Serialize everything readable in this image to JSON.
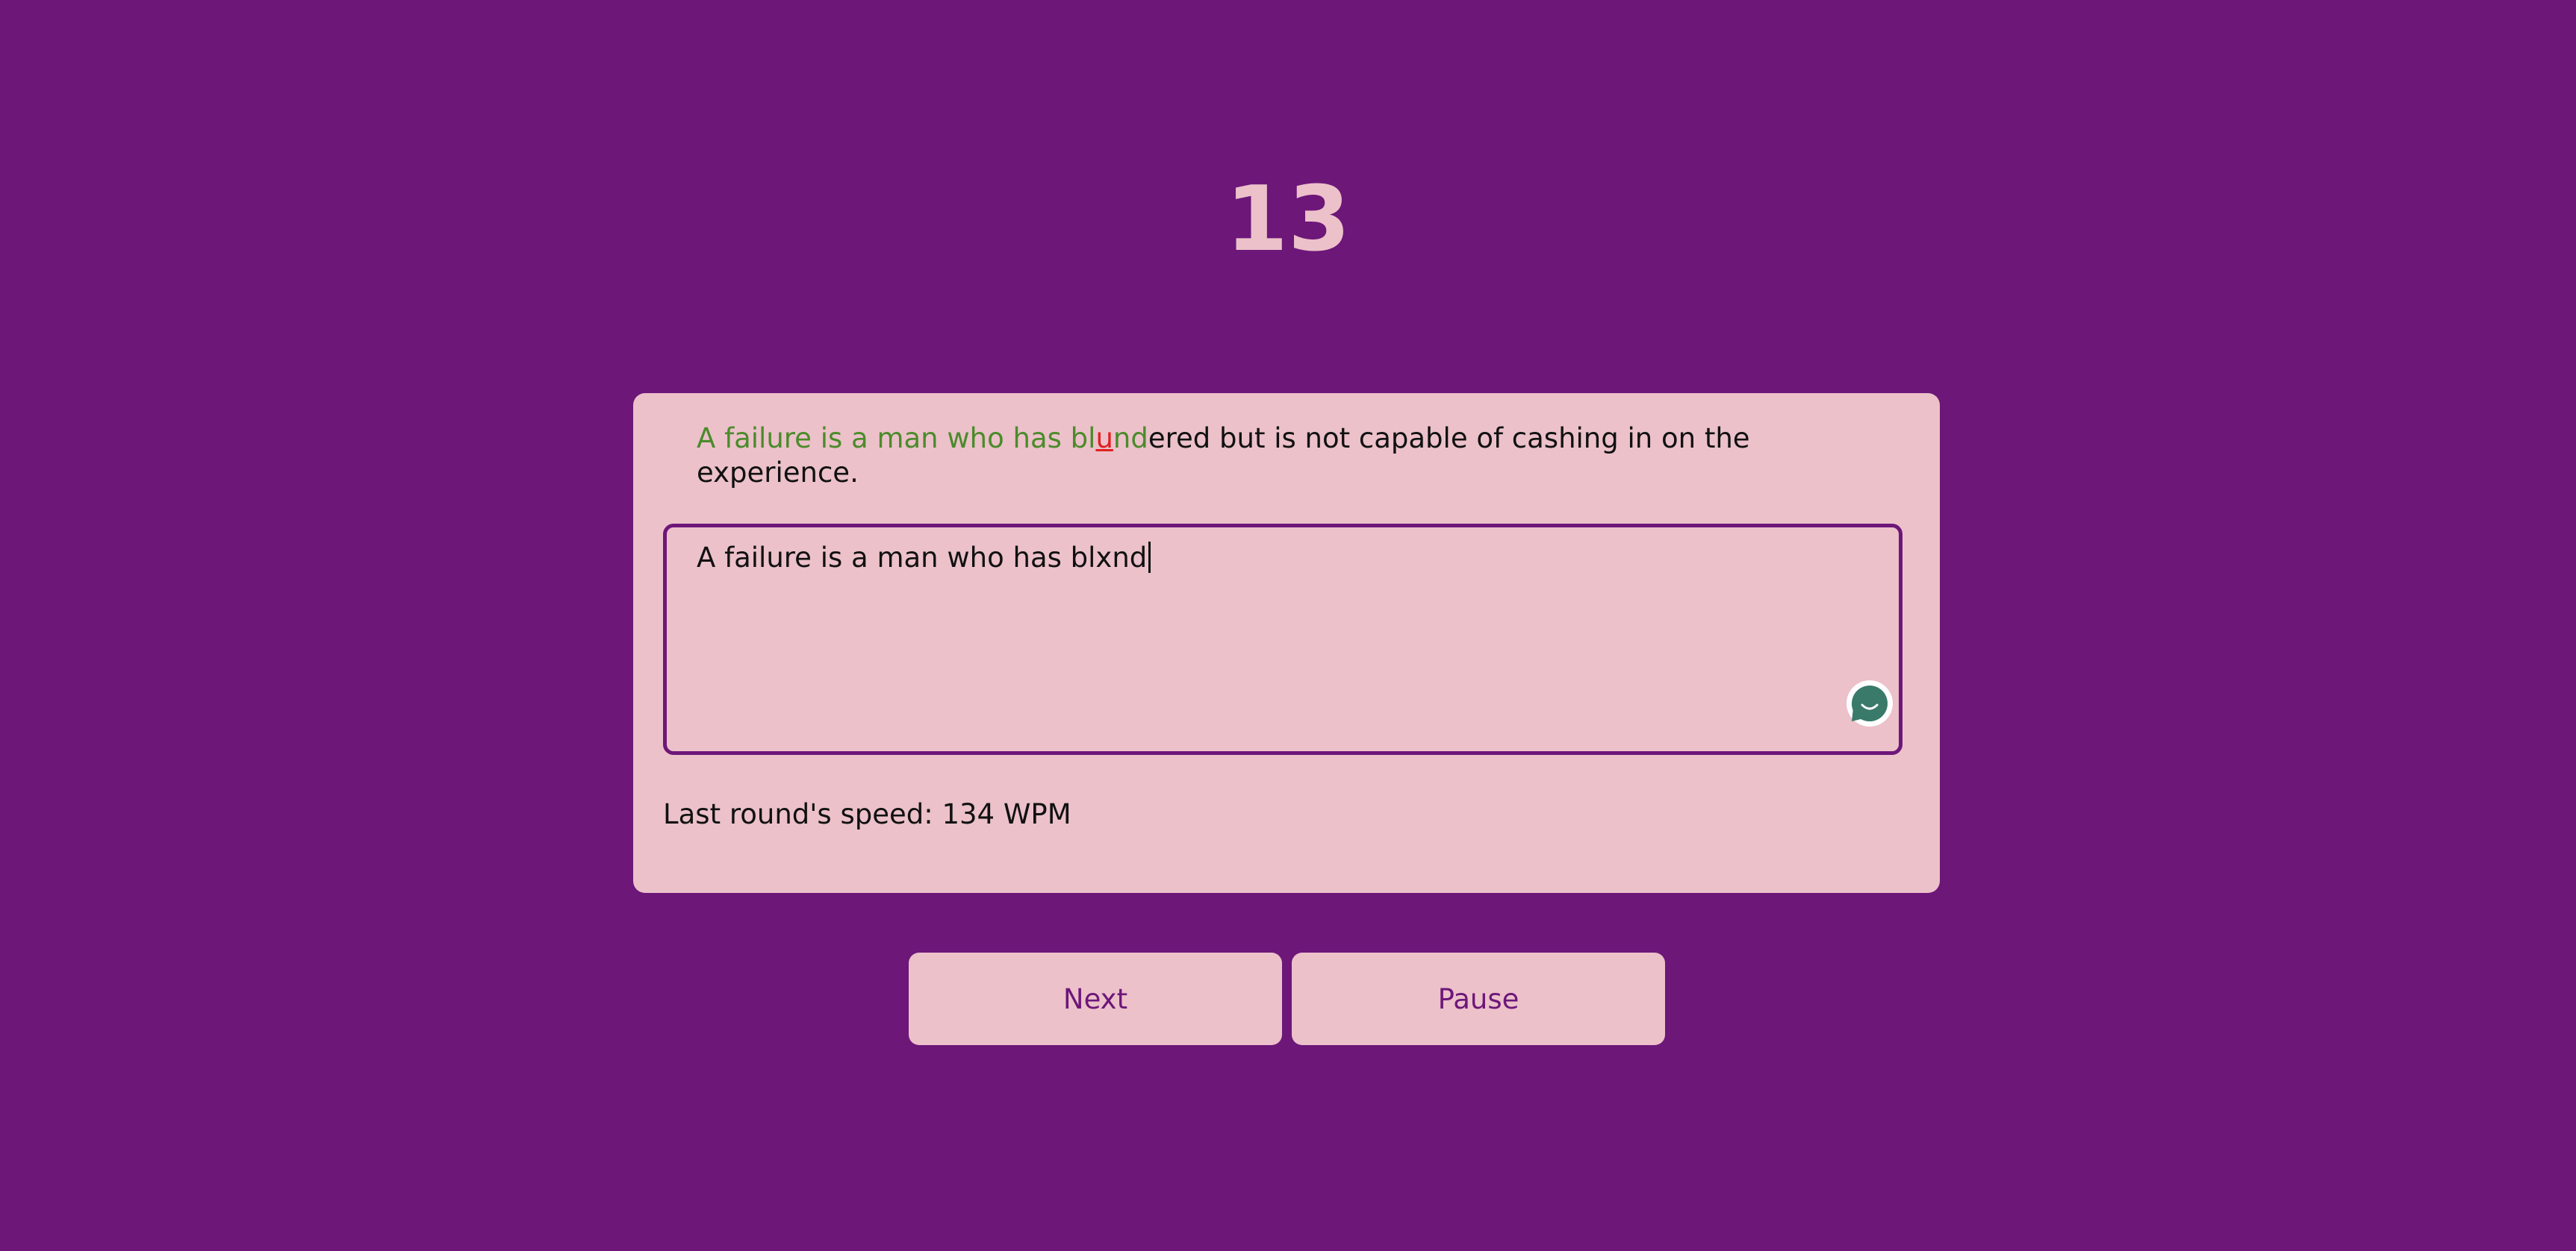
{
  "timer": {
    "value": "13"
  },
  "prompt": {
    "correct_prefix": "A failure is a man who has bl",
    "error_char": "u",
    "correct_after_error": "nd",
    "remaining": "ered but is not capable of cashing in on the experience."
  },
  "input": {
    "value": "A failure is a man who has blxnd"
  },
  "assistant_icon": {
    "name": "chat-assistant-icon",
    "color": "#3a7a6a"
  },
  "stats": {
    "last_round_speed": "Last round's speed: 134 WPM"
  },
  "buttons": {
    "next_label": "Next",
    "pause_label": "Pause"
  },
  "colors": {
    "background": "#6d1779",
    "card": "#ecc1ca",
    "correct": "#4b8b2a",
    "error": "#e02020"
  }
}
